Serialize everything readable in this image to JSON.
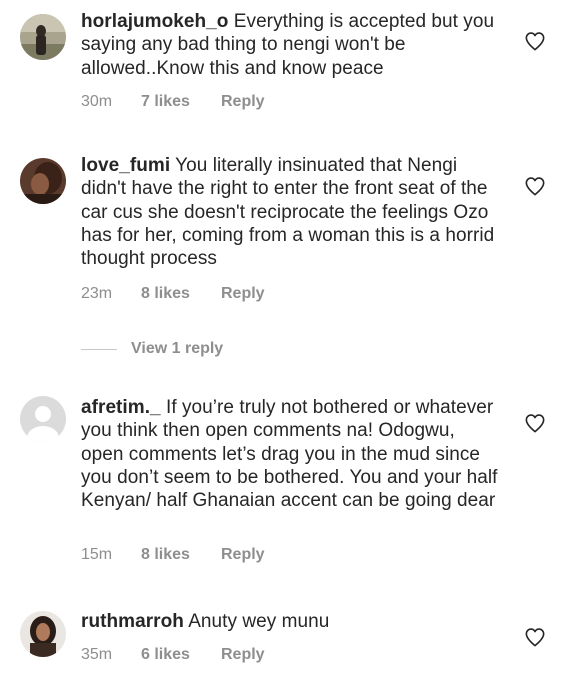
{
  "comments": [
    {
      "username": "horlajumokeh_o",
      "text": "Everything is accepted but you saying any bad thing to nengi won't be allowed..Know this and know peace",
      "time": "30m",
      "likes": "7 likes",
      "reply": "Reply"
    },
    {
      "username": "love_fumi",
      "text": "You literally insinuated that Nengi didn't have the right to enter the front seat of the car cus she doesn't reciprocate the feelings Ozo has for her, coming from a woman this is a horrid thought process",
      "time": "23m",
      "likes": "8 likes",
      "reply": "Reply"
    },
    {
      "username": "afretim._",
      "text": "If you’re truly not bothered or whatever you think then open comments na! Odogwu, open comments let’s drag you in the mud since you don’t seem to be bothered. You and your half Kenyan/ half Ghanaian accent can be going dear",
      "time": "15m",
      "likes": "8 likes",
      "reply": "Reply"
    },
    {
      "username": "ruthmarroh",
      "text": "Anuty wey munu",
      "time": "35m",
      "likes": "6 likes",
      "reply": "Reply"
    }
  ],
  "view_replies": "View 1 reply",
  "icons": {
    "like": "heart-outline-icon"
  },
  "colors": {
    "text": "#262626",
    "meta": "#8e8e8e",
    "divider": "#c7c7c7"
  }
}
